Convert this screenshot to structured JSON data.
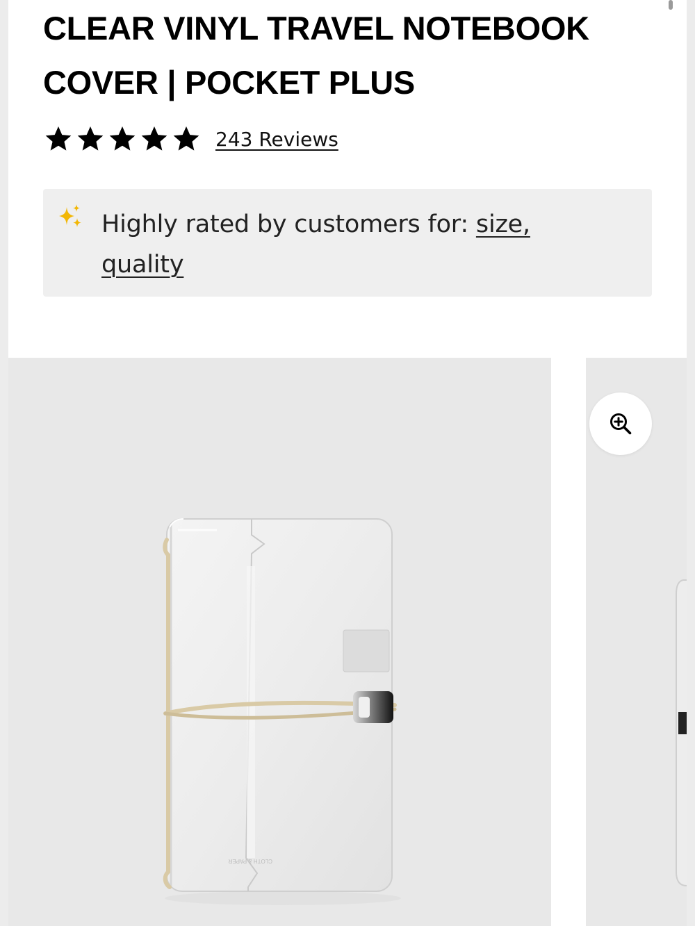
{
  "product": {
    "title_line1": "CLEAR VINYL TRAVEL NOTEBOOK",
    "title_line2": "COVER | POCKET PLUS"
  },
  "rating": {
    "stars": 5,
    "max_stars": 5,
    "reviews_label": "243 Reviews"
  },
  "highlights": {
    "prefix": "Highly rated by customers for: ",
    "attributes": [
      "size",
      "quality"
    ],
    "separator": ",",
    "icon": "sparkle-icon"
  },
  "gallery": {
    "zoom_icon": "zoom-in-icon",
    "main_image": "clear-vinyl-notebook-cover-image",
    "next_image": "next-product-image-partial",
    "imprint": "CLOTH & PAPER"
  },
  "colors": {
    "text": "#111111",
    "star": "#000000",
    "sparkle": "#f2b705",
    "panel": "#efefef",
    "image_bg": "#e8e8e8"
  }
}
